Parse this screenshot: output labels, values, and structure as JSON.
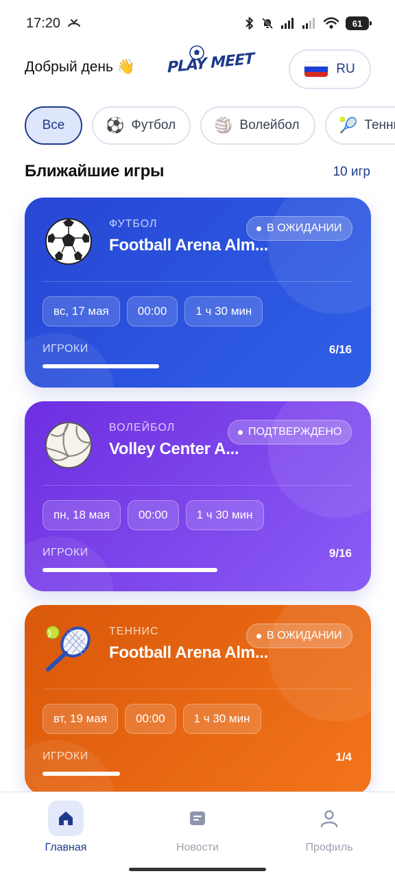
{
  "status_bar": {
    "time": "17:20",
    "battery": "61"
  },
  "header": {
    "greeting": "Добрый день 👋",
    "logo_text": "PLAY MEET",
    "language": "RU"
  },
  "filters": [
    {
      "label": "Все",
      "icon": ""
    },
    {
      "label": "Футбол",
      "icon": "⚽"
    },
    {
      "label": "Волейбол",
      "icon": "🏐"
    },
    {
      "label": "Теннис",
      "icon": "🎾"
    }
  ],
  "section": {
    "title": "Ближайшие игры",
    "count": "10 игр"
  },
  "games": [
    {
      "sport": "ФУТБОЛ",
      "venue": "Football Arena Alm...",
      "status": "В ОЖИДАНИИ",
      "date": "вс, 17 мая",
      "time": "00:00",
      "duration": "1 ч 30 мин",
      "players_label": "ИГРОКИ",
      "players": "6/16",
      "fill_fraction": 0.375
    },
    {
      "sport": "ВОЛЕЙБОЛ",
      "venue": "Volley Center A...",
      "status": "ПОДТВЕРЖДЕНО",
      "date": "пн, 18 мая",
      "time": "00:00",
      "duration": "1 ч 30 мин",
      "players_label": "ИГРОКИ",
      "players": "9/16",
      "fill_fraction": 0.5625
    },
    {
      "sport": "ТЕННИС",
      "venue": "Football Arena Alm...",
      "status": "В ОЖИДАНИИ",
      "date": "вт, 19 мая",
      "time": "00:00",
      "duration": "1 ч 30 мин",
      "players_label": "ИГРОКИ",
      "players": "1/4",
      "fill_fraction": 0.25
    }
  ],
  "nav": [
    {
      "label": "Главная",
      "icon": "home-icon",
      "active": true
    },
    {
      "label": "Новости",
      "icon": "news-icon",
      "active": false
    },
    {
      "label": "Профиль",
      "icon": "profile-icon",
      "active": false
    }
  ],
  "colors": {
    "accent": "#1e3a8a",
    "football_card": "#2747d4",
    "volley_card": "#7c3aed",
    "tennis_card": "#ea6a14"
  }
}
